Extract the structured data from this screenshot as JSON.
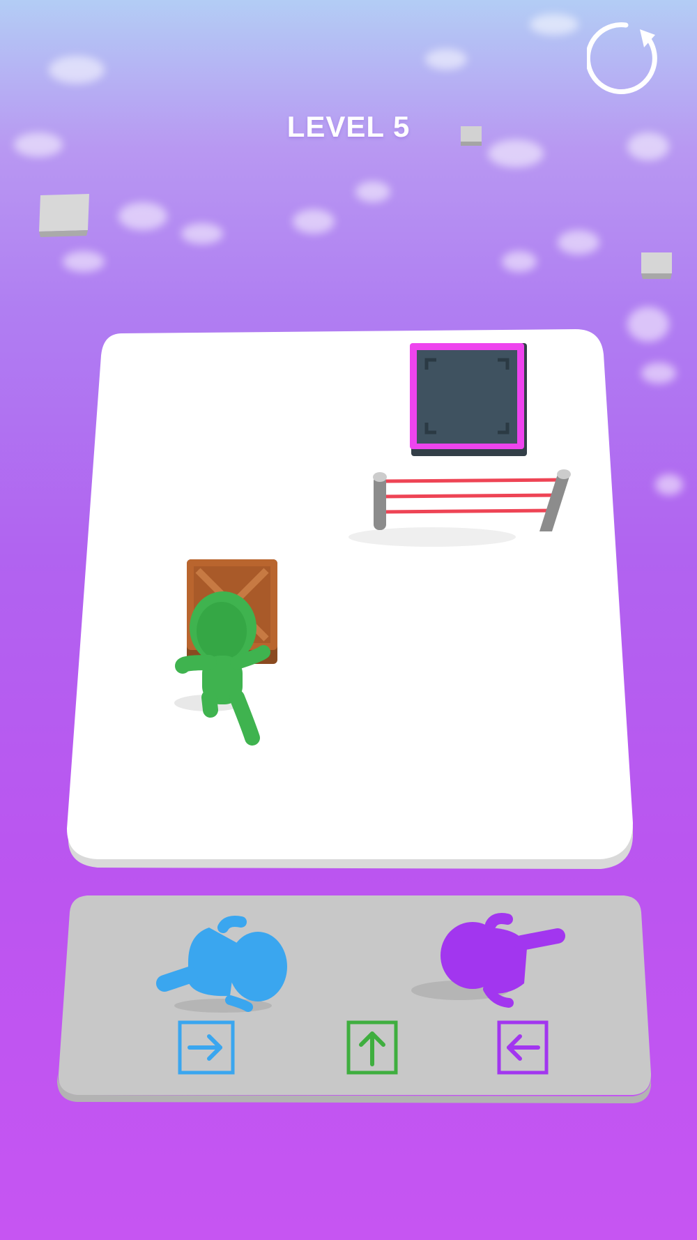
{
  "hud": {
    "level_label": "LEVEL 5",
    "restart_icon": "restart-icon"
  },
  "scene": {
    "characters": [
      {
        "name": "green-character",
        "color": "#3fb34f",
        "state": "pushing-crate"
      },
      {
        "name": "blue-character",
        "color": "#3aa6ef",
        "state": "lying-in-tray"
      },
      {
        "name": "purple-character",
        "color": "#a236ef",
        "state": "lying-in-tray"
      }
    ],
    "objects": [
      "wooden-crate",
      "exit-pit",
      "laser-fence"
    ]
  },
  "controls": [
    {
      "name": "blue-right-arrow",
      "icon": "arrow-right-icon",
      "color": "#3aa6ef"
    },
    {
      "name": "green-up-arrow",
      "icon": "arrow-up-icon",
      "color": "#3fae3f"
    },
    {
      "name": "purple-left-arrow",
      "icon": "arrow-left-icon",
      "color": "#a236ef"
    }
  ],
  "colors": {
    "board": "#ffffff",
    "tray": "#c8c8c8",
    "pit_border": "#ee44ee",
    "pit_floor": "#3f5260",
    "laser": "#ee4455",
    "crate": "#b9652e"
  }
}
